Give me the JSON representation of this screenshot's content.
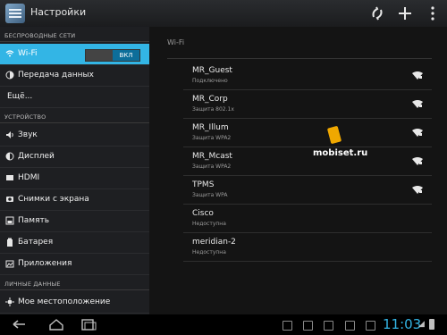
{
  "actionbar": {
    "title": "Настройки"
  },
  "sidebar": {
    "sections": [
      {
        "title": "БЕСПРОВОДНЫЕ СЕТИ"
      },
      {
        "title": "УСТРОЙСТВО"
      },
      {
        "title": "ЛИЧНЫЕ ДАННЫЕ"
      }
    ],
    "items": [
      {
        "label": "Wi-Fi",
        "toggle": "ВКЛ"
      },
      {
        "label": "Передача данных"
      },
      {
        "label": "Ещё..."
      },
      {
        "label": "Звук"
      },
      {
        "label": "Дисплей"
      },
      {
        "label": "HDMI"
      },
      {
        "label": "Снимки с экрана"
      },
      {
        "label": "Память"
      },
      {
        "label": "Батарея"
      },
      {
        "label": "Приложения"
      },
      {
        "label": "Мое местоположение"
      }
    ]
  },
  "wifi": {
    "header": "Wi-Fi",
    "networks": [
      {
        "name": "MR_Guest",
        "status": "Подключено"
      },
      {
        "name": "MR_Corp",
        "status": "Защита 802.1x"
      },
      {
        "name": "MR_Illum",
        "status": "Защита WPA2"
      },
      {
        "name": "MR_Mcast",
        "status": "Защита WPA2"
      },
      {
        "name": "TPMS",
        "status": "Защита WPA"
      },
      {
        "name": "Cisco",
        "status": "Недоступна"
      },
      {
        "name": "meridian-2",
        "status": "Недоступна"
      }
    ]
  },
  "watermark": {
    "text": "mobiset.ru"
  },
  "statusbar": {
    "time": "11:03"
  },
  "colors": {
    "accent": "#33b5e5",
    "background": "#121212"
  },
  "icons": [
    "settings-app-icon",
    "sync-icon",
    "add-icon",
    "wifi-icon",
    "data-usage-icon",
    "sound-icon",
    "display-icon",
    "hdmi-icon",
    "screenshot-icon",
    "storage-icon",
    "battery-icon",
    "apps-icon",
    "location-icon",
    "wifi-signal-icon",
    "back-icon",
    "home-icon",
    "recents-icon"
  ]
}
